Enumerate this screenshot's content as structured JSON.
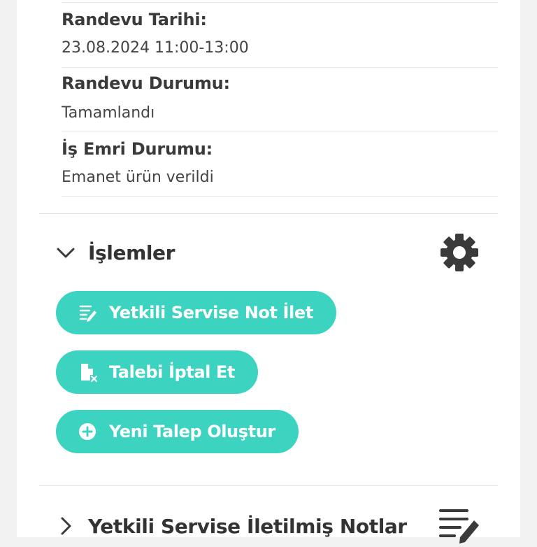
{
  "appointment": {
    "date_label": "Randevu Tarihi:",
    "date_value": "23.08.2024 11:00-13:00",
    "status_label": "Randevu Durumu:",
    "status_value": "Tamamlandı",
    "work_order_label": "İş Emri Durumu:",
    "work_order_value": "Emanet ürün verildi"
  },
  "operations": {
    "title": "İşlemler",
    "expanded": true,
    "settings_icon": "gear-icon",
    "buttons": [
      {
        "label": "Yetkili Servise Not İlet",
        "icon": "note-send-icon"
      },
      {
        "label": "Talebi İptal Et",
        "icon": "document-cancel-icon"
      },
      {
        "label": "Yeni Talep Oluştur",
        "icon": "plus-circle-icon"
      }
    ]
  },
  "notes": {
    "title": "Yetkili Servise İletilmiş Notlar",
    "expanded": false,
    "icon": "notes-edit-icon"
  },
  "colors": {
    "accent": "#3cd3c1",
    "text_dark": "#333333",
    "icon_gray": "#3a3a3a"
  }
}
